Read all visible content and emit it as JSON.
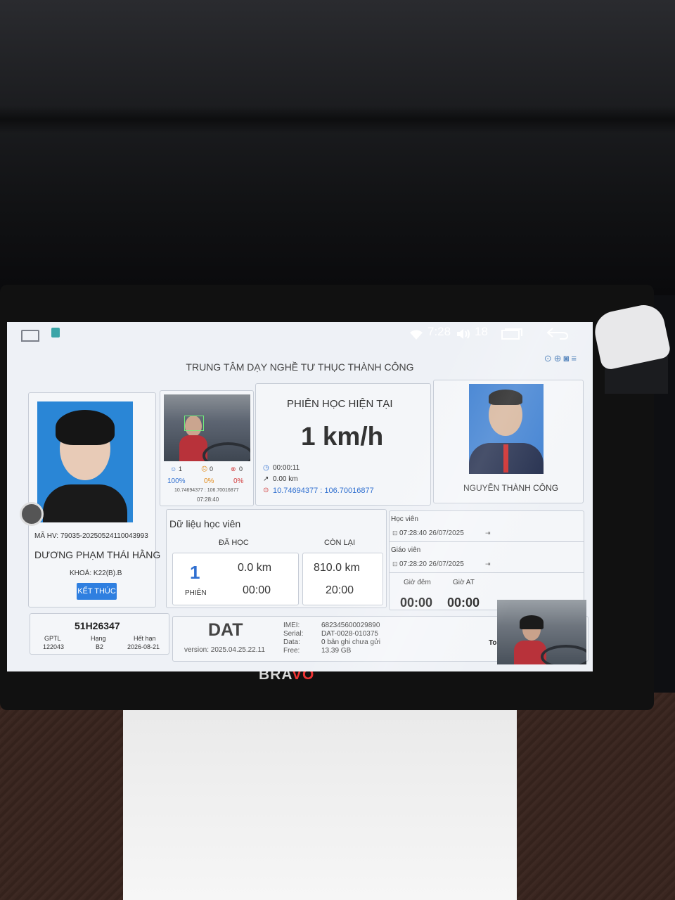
{
  "status_bar": {
    "time": "7:28",
    "volume": "18"
  },
  "header": {
    "center_name": "TRUNG TÂM DẠY NGHỀ TƯ THỤC THÀNH CÔNG"
  },
  "student": {
    "code": "MÃ HV: 79035-20250524110043993",
    "name": "DƯƠNG PHẠM THÁI HẰNG",
    "course": "KHOÁ: K22(B).B",
    "end_button": "KẾT THÚC"
  },
  "camera_stats": {
    "face_count": "1",
    "face_pct": "100%",
    "warn_count": "0",
    "warn_pct": "0%",
    "err_count": "0",
    "err_pct": "0%",
    "coords": "10.74694377 : 106.70016877",
    "time": "07:28:40"
  },
  "session": {
    "title": "PHIÊN HỌC HIỆN TẠI",
    "speed": "1 km/h",
    "duration": "00:00:11",
    "distance": "0.00 km",
    "gps": "10.74694377 : 106.70016877"
  },
  "teacher": {
    "name": "NGUYỄN THÀNH CÔNG"
  },
  "student_data": {
    "title": "Dữ liệu học viên",
    "done_header": "ĐÃ HỌC",
    "remaining_header": "CÒN LẠI",
    "sessions_value": "1",
    "sessions_label": "PHIÊN",
    "done_km": "0.0 km",
    "done_time": "00:00",
    "remaining_km": "810.0 km",
    "remaining_time": "20:00"
  },
  "logins": {
    "student_label": "Học viên",
    "student_time": "07:28:40 26/07/2025",
    "teacher_label": "Giáo viên",
    "teacher_time": "07:28:20 26/07/2025",
    "night_label": "Giờ đêm",
    "night_value": "00:00",
    "at_label": "Giờ AT",
    "at_value": "00:00"
  },
  "vehicle": {
    "plate": "51H26347",
    "gptl_label": "GPTL",
    "gptl_value": "122043",
    "class_label": "Hạng",
    "class_value": "B2",
    "expiry_label": "Hết hạn",
    "expiry_value": "2026-08-21"
  },
  "device": {
    "name": "DAT",
    "version": "version: 2025.04.25.22.11",
    "imei_label": "IMEI:",
    "imei_value": "682345600029890",
    "serial_label": "Serial:",
    "serial_value": "DAT-0028-010375",
    "data_label": "Data:",
    "data_value": "0 bản ghi chưa gửi",
    "free_label": "Free:",
    "free_value": "13.39 GB",
    "overlay_text": "To"
  },
  "hardware": {
    "brand_left": "BRA",
    "brand_right": "VO"
  },
  "colors": {
    "accent_blue": "#2f6fd0",
    "button_blue": "#2f7fe0",
    "photo_blue": "#2a86d6",
    "warn_orange": "#e28b1b",
    "error_red": "#d23c3c"
  }
}
